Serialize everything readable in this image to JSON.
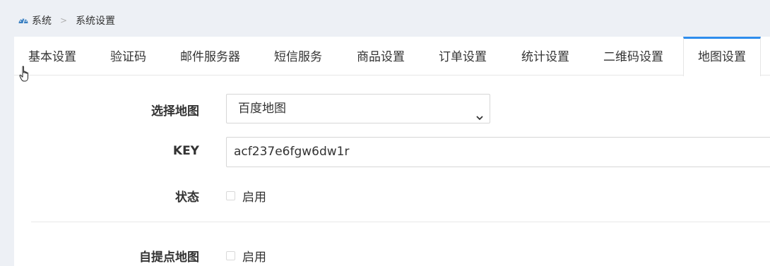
{
  "breadcrumb": {
    "home_icon": "dashboard-icon",
    "root": "系统",
    "separator": ">",
    "current": "系统设置"
  },
  "tabs": [
    {
      "label": "基本设置",
      "active": false
    },
    {
      "label": "验证码",
      "active": false
    },
    {
      "label": "邮件服务器",
      "active": false
    },
    {
      "label": "短信服务",
      "active": false
    },
    {
      "label": "商品设置",
      "active": false
    },
    {
      "label": "订单设置",
      "active": false
    },
    {
      "label": "统计设置",
      "active": false
    },
    {
      "label": "二维码设置",
      "active": false
    },
    {
      "label": "地图设置",
      "active": true
    }
  ],
  "form": {
    "map_select": {
      "label": "选择地图",
      "value": "百度地图"
    },
    "key": {
      "label": "KEY",
      "value": "acf237e6fgw6dw1r"
    },
    "status": {
      "label": "状态",
      "checkbox_label": "启用",
      "checked": false
    },
    "pickup_map": {
      "label": "自提点地图",
      "checkbox_label": "启用",
      "checked": false
    }
  },
  "colors": {
    "accent": "#2e8ded",
    "background": "#edf0f5",
    "panel": "#ffffff",
    "border": "#d6d6d6"
  }
}
